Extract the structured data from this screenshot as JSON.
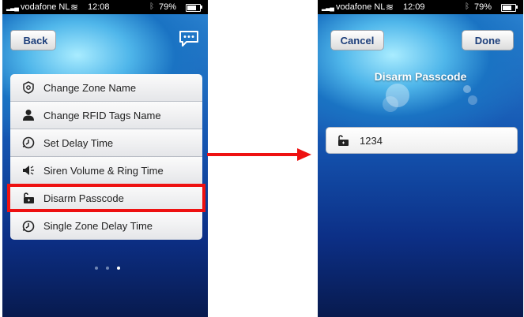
{
  "colors": {
    "highlight": "#ee1111",
    "nav_text": "#1c3e7a"
  },
  "left_screen": {
    "status": {
      "carrier": "vodafone NL",
      "time": "12:08",
      "battery": "79%"
    },
    "back_label": "Back",
    "chat_icon": "chat-bubble-icon",
    "menu": [
      {
        "label": "Change Zone Name",
        "icon": "zone-shield-icon"
      },
      {
        "label": "Change RFID Tags Name",
        "icon": "person-icon"
      },
      {
        "label": "Set Delay Time",
        "icon": "clock-icon"
      },
      {
        "label": "Siren Volume & Ring Time",
        "icon": "siren-speaker-icon"
      },
      {
        "label": "Disarm Passcode",
        "icon": "unlocked-padlock-icon",
        "highlighted": true
      },
      {
        "label": "Single Zone Delay Time",
        "icon": "clock-icon"
      }
    ],
    "page_indicator": {
      "pages": 3,
      "current": 3
    }
  },
  "right_screen": {
    "status": {
      "carrier": "vodafone NL",
      "time": "12:09",
      "battery": "79%"
    },
    "cancel_label": "Cancel",
    "done_label": "Done",
    "title": "Disarm Passcode",
    "passcode_value": "1234",
    "field_icon": "unlocked-padlock-icon"
  },
  "annotation": {
    "arrow": "red-arrow-left-to-right"
  }
}
